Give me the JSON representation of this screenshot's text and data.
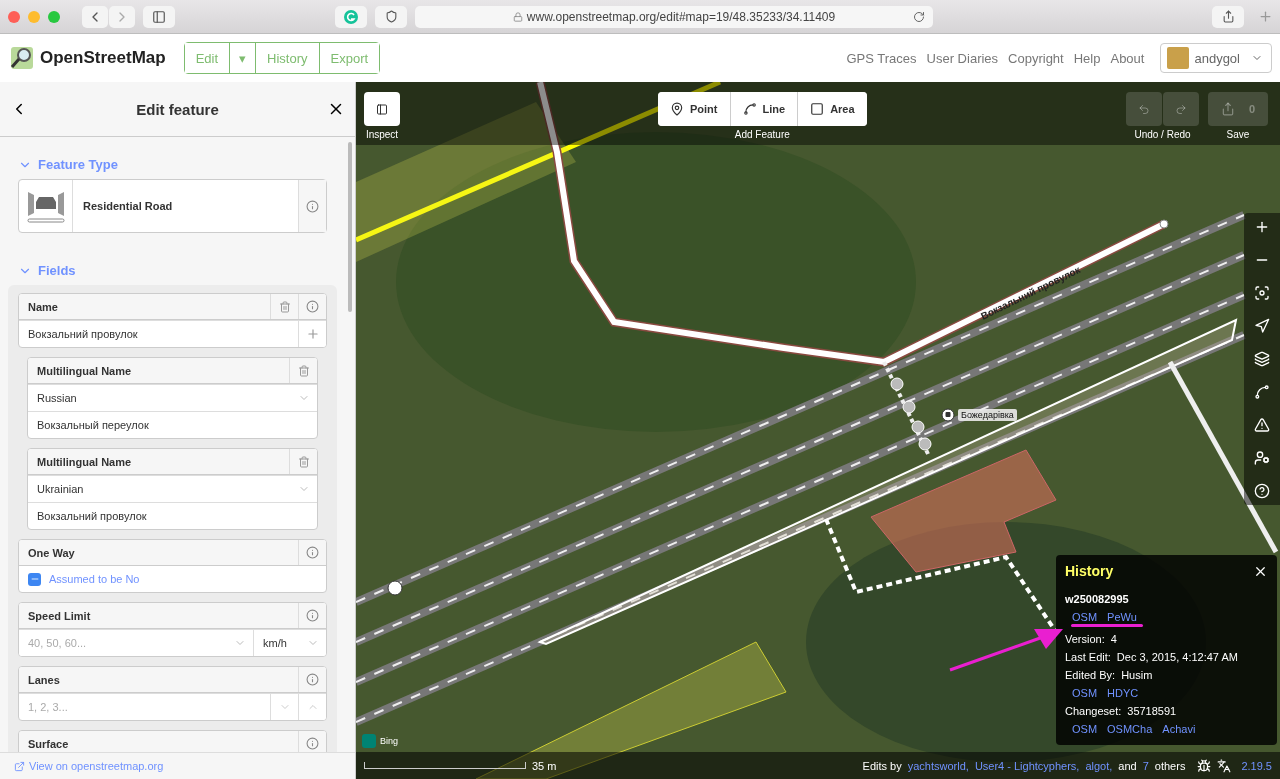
{
  "browser": {
    "url": "www.openstreetmap.org/edit#map=19/48.35233/34.11409"
  },
  "header": {
    "site_name": "OpenStreetMap",
    "nav_buttons": [
      {
        "label": "Edit",
        "kind": "text"
      },
      {
        "label": "▾",
        "kind": "caret"
      },
      {
        "label": "History",
        "kind": "text"
      },
      {
        "label": "Export",
        "kind": "text"
      }
    ],
    "links": [
      "GPS Traces",
      "User Diaries",
      "Copyright",
      "Help",
      "About"
    ],
    "user": "andygol"
  },
  "sidebar": {
    "title": "Edit feature",
    "feature_type_section": "Feature Type",
    "preset": "Residential Road",
    "fields_section": "Fields",
    "fields": [
      {
        "kind": "name",
        "label": "Name",
        "value": "Вокзальний провулок"
      },
      {
        "kind": "multilingual",
        "label": "Multilingual Name",
        "language": "Russian",
        "value": "Вокзальный переулок"
      },
      {
        "kind": "multilingual",
        "label": "Multilingual Name",
        "language": "Ukrainian",
        "value": "Вокзальний провулок"
      },
      {
        "kind": "check",
        "label": "One Way",
        "value": "Assumed to be No",
        "indeterminate": true
      },
      {
        "kind": "unit",
        "label": "Speed Limit",
        "placeholder": "40, 50, 60...",
        "unit": "km/h"
      },
      {
        "kind": "number",
        "label": "Lanes",
        "placeholder": "1, 2, 3..."
      },
      {
        "kind": "header",
        "label": "Surface"
      }
    ],
    "footer_link": "View on openstreetmap.org"
  },
  "map": {
    "inspect": {
      "caption": "Inspect"
    },
    "add_feature": {
      "buttons": [
        {
          "label": "Point",
          "kind": "point"
        },
        {
          "label": "Line",
          "kind": "line"
        },
        {
          "label": "Area",
          "kind": "area"
        }
      ],
      "caption": "Add Feature"
    },
    "undo_redo": {
      "caption": "Undo / Redo",
      "undo_disabled": true,
      "redo_disabled": true
    },
    "save": {
      "count": "0",
      "caption": "Save",
      "disabled": true
    },
    "street_label": "Вокзальний провулок",
    "stop_label": "Божедарівка",
    "imagery": "Bing",
    "scale": "35 m",
    "attribution": {
      "prefix": "Edits by",
      "contributors": [
        "yachtsworld,",
        "User4 - Lightcyphers,",
        "algot,"
      ],
      "joiner": "and",
      "more_count": "7",
      "suffix": "others"
    },
    "version": "2.19.5"
  },
  "history": {
    "title": "History",
    "entity": "w250082995",
    "entity_links": [
      "OSM",
      "PeWu"
    ],
    "rows": [
      {
        "label": "Version:",
        "value": "4"
      },
      {
        "label": "Last Edit:",
        "value": "Dec 3, 2015, 4:12:47 AM"
      },
      {
        "label": "Edited By:",
        "value": "Husim",
        "links": [
          "OSM",
          "HDYC"
        ]
      },
      {
        "label": "Changeset:",
        "value": "35718591",
        "links": [
          "OSM",
          "OSMCha",
          "Achavi"
        ]
      }
    ]
  }
}
